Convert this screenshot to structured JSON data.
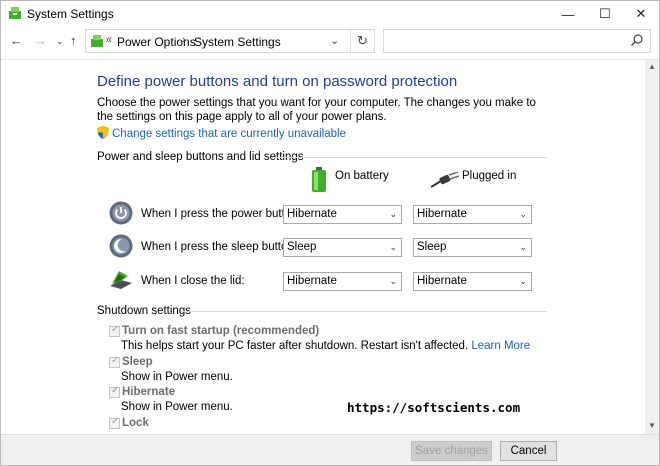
{
  "window": {
    "title": "System Settings",
    "controls": {
      "minimize": "—",
      "maximize": "☐",
      "close": "✕"
    }
  },
  "nav": {
    "back": "←",
    "forward": "→",
    "recent": "⌄",
    "up": "↑",
    "address_chevron": "«",
    "breadcrumb": [
      "Power Options",
      "System Settings"
    ],
    "separator": "›",
    "dropdown": "⌄",
    "refresh": "↻",
    "search_placeholder": ""
  },
  "page": {
    "heading": "Define power buttons and turn on password protection",
    "intro": "Choose the power settings that you want for your computer. The changes you make to the settings on this page apply to all of your power plans.",
    "change_link": "Change settings that are currently unavailable",
    "power_section": "Power and sleep buttons and lid settings",
    "columns": {
      "battery": "On battery",
      "plugged": "Plugged in"
    },
    "rows": [
      {
        "label": "When I press the power button:",
        "battery": "Hibernate",
        "plugged": "Hibernate",
        "icon": "power-button-icon"
      },
      {
        "label": "When I press the sleep button:",
        "battery": "Sleep",
        "plugged": "Sleep",
        "icon": "sleep-button-icon"
      },
      {
        "label": "When I close the lid:",
        "battery": "Hibernate",
        "plugged": "Hibernate",
        "icon": "laptop-lid-icon"
      }
    ],
    "shutdown_section": "Shutdown settings",
    "shutdown": [
      {
        "label": "Turn on fast startup (recommended)",
        "checked": true,
        "desc": "This helps start your PC faster after shutdown. Restart isn't affected.",
        "link": "Learn More"
      },
      {
        "label": "Sleep",
        "checked": true,
        "desc": "Show in Power menu."
      },
      {
        "label": "Hibernate",
        "checked": true,
        "desc": "Show in Power menu."
      },
      {
        "label": "Lock",
        "checked": true
      }
    ],
    "watermark": "https://softscients.com"
  },
  "footer": {
    "save": "Save changes",
    "cancel": "Cancel"
  },
  "colors": {
    "heading": "#1e3f9a",
    "link": "#1a64c8",
    "battery_green": "#3fae2a"
  }
}
